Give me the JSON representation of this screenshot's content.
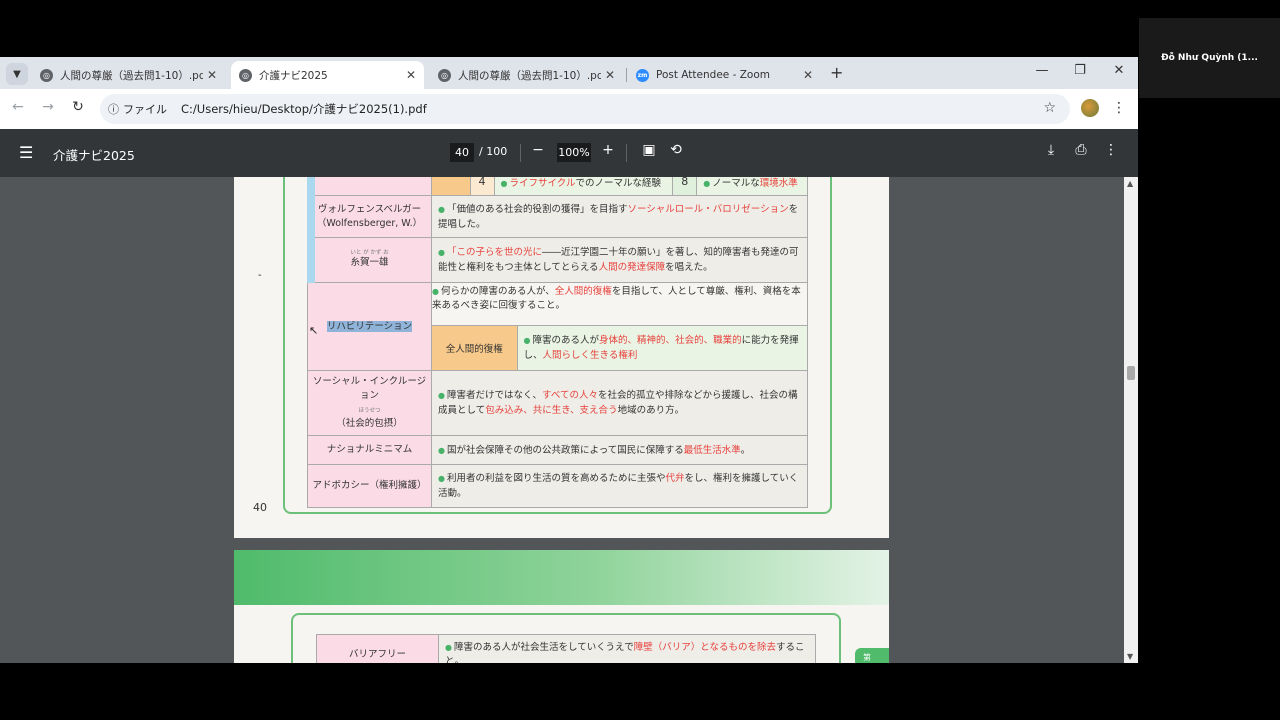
{
  "zoom_participant": "Đỗ Như Quỳnh (1...",
  "tabs": [
    {
      "label": "人間の尊厳（過去問1-10）.pdf",
      "favicon": "globe-icon"
    },
    {
      "label": "介護ナビ2025",
      "favicon": "globe-icon"
    },
    {
      "label": "人間の尊厳（過去問1-10）.pdf",
      "favicon": "globe-icon"
    },
    {
      "label": "Post Attendee - Zoom",
      "favicon": "zoom-icon",
      "favicon_text": "zm"
    }
  ],
  "address": {
    "chip": "ファイル",
    "url": "C:/Users/hieu/Desktop/介護ナビ2025(1).pdf"
  },
  "pdf": {
    "title": "介護ナビ2025",
    "current_page": "40",
    "total_pages": "/ 100",
    "zoom": "100%"
  },
  "page1": {
    "page_number": "40",
    "row_top": {
      "num1": "4",
      "text1_red": "ライフサイクル",
      "text1_rest": "でのノーマルな経験",
      "num2": "8",
      "text2_plain": "ノーマルな",
      "text2_red": "環境水準"
    },
    "wolf": {
      "term": "ヴォルフェンスベルガー（Wolfensberger, W.）",
      "d1": "「価値のある社会的役割の獲得」を目指す",
      "d_red": "ソーシャルロール・バロリゼーション",
      "d2": "を提唱した。"
    },
    "itoga": {
      "ruby": "いと が かず お",
      "term": "糸賀一雄",
      "d_red1": "「この子らを世の光に",
      "d1": "――近江学園二十年の願い」を著し、知的障害者も発達の可能性と権利をもつ主体としてとらえる",
      "d_red2": "人間の発達保障",
      "d2": "を唱えた。"
    },
    "rehab": {
      "term": "リハビリテーション",
      "d1": "何らかの障害のある人が、",
      "d_red": "全人間的復権",
      "d2": "を目指して、人として尊厳、権利、資格を本来あるべき姿に回復すること。",
      "sub_term": "全人間的復権",
      "s1": "障害のある人が",
      "s_red1": "身体的",
      "s_sep1": "、",
      "s_red2": "精神的",
      "s_sep2": "、",
      "s_red3": "社会的",
      "s_sep3": "、",
      "s_red4": "職業的",
      "s2": "に能力を発揮し、",
      "s_red5": "人間らしく生きる権利"
    },
    "inclusion": {
      "term1": "ソーシャル・インクルージョン",
      "ruby": "ほうせつ",
      "term2": "（社会的包摂）",
      "d1": "障害者だけではなく、",
      "d_red1": "すべての人々",
      "d2": "を社会的孤立や排除などから援護し、社会の構成員として",
      "d_red2": "包み込み、共に生き、支え合う",
      "d3": "地域のあり方。"
    },
    "minimum": {
      "term": "ナショナルミニマム",
      "d1": "国が社会保障その他の公共政策によって国民に保障する",
      "d_red": "最低生活水準",
      "d2": "。"
    },
    "advocacy": {
      "term": "アドボカシー（権利擁護）",
      "d1": "利用者の利益を図り生活の質を高めるために主張や",
      "d_red": "代弁",
      "d2": "をし、権利を擁護していく活動。"
    }
  },
  "page2": {
    "term": "バリアフリー",
    "d1": "障害のある人が社会生活をしていくうえで",
    "d_red": "障壁（バリア）となるものを除去",
    "d2": "すること。",
    "side_tab": "第"
  },
  "colors": {
    "accent_red": "#e8413c",
    "term_pink": "#fadbe6",
    "frame_green": "#6cc07a",
    "highlight": "#8fb3d9"
  }
}
